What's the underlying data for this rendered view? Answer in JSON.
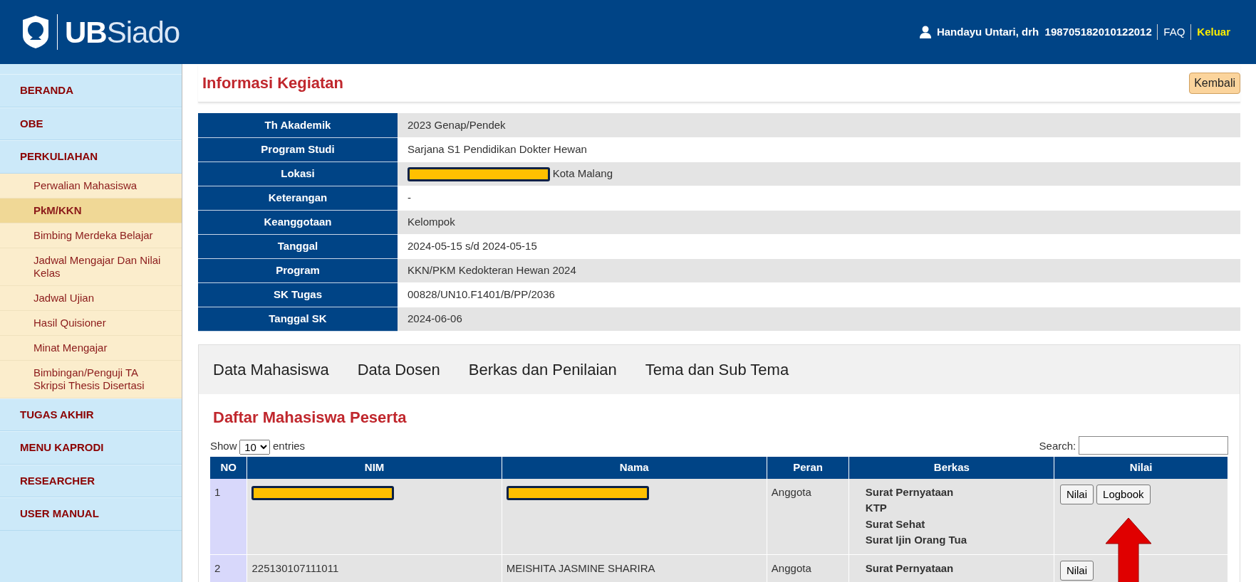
{
  "header": {
    "logo_bold": "UB",
    "logo_light": "Siado",
    "user": "Handayu Untari, drh  198705182010122012",
    "links": [
      {
        "label": "FAQ",
        "kind": "plain"
      },
      {
        "label": "Keluar",
        "kind": "highlight"
      }
    ]
  },
  "sidebar": {
    "items": [
      {
        "label": "BERANDA",
        "selected": false
      },
      {
        "label": "OBE",
        "selected": false
      },
      {
        "label": "PERKULIAHAN",
        "selected": false,
        "children": [
          {
            "label": "Perwalian Mahasiswa",
            "selected": false
          },
          {
            "label": "PkM/KKN",
            "selected": true
          },
          {
            "label": "Bimbing Merdeka Belajar",
            "selected": false
          },
          {
            "label": "Jadwal Mengajar Dan Nilai Kelas",
            "selected": false
          },
          {
            "label": "Jadwal Ujian",
            "selected": false
          },
          {
            "label": "Hasil Quisioner",
            "selected": false
          },
          {
            "label": "Minat Mengajar",
            "selected": false
          },
          {
            "label": "Bimbingan/Penguji TA Skripsi Thesis Disertasi",
            "selected": false
          }
        ]
      },
      {
        "label": "TUGAS AKHIR",
        "selected": false
      },
      {
        "label": "MENU KAPRODI",
        "selected": false
      },
      {
        "label": "RESEARCHER",
        "selected": false
      },
      {
        "label": "USER MANUAL",
        "selected": false
      }
    ]
  },
  "page": {
    "title": "Informasi Kegiatan",
    "back_button": "Kembali"
  },
  "info": [
    {
      "label": "Th Akademik",
      "value": "2023 Genap/Pendek",
      "redacted": false
    },
    {
      "label": "Program Studi",
      "value": "Sarjana S1 Pendidikan Dokter Hewan",
      "redacted": false
    },
    {
      "label": "Lokasi",
      "value": "Kota Malang",
      "redacted": true
    },
    {
      "label": "Keterangan",
      "value": "-",
      "redacted": false
    },
    {
      "label": "Keanggotaan",
      "value": "Kelompok",
      "redacted": false
    },
    {
      "label": "Tanggal",
      "value": "2024-05-15 s/d 2024-05-15",
      "redacted": false
    },
    {
      "label": "Program",
      "value": "KKN/PKM Kedokteran Hewan 2024",
      "redacted": false
    },
    {
      "label": "SK Tugas",
      "value": "00828/UN10.F1401/B/PP/2036",
      "redacted": false
    },
    {
      "label": "Tanggal SK",
      "value": "2024-06-06",
      "redacted": false
    }
  ],
  "tabs": [
    {
      "label": "Data Mahasiswa",
      "selected": false
    },
    {
      "label": "Data Dosen",
      "selected": false
    },
    {
      "label": "Berkas dan Penilaian",
      "selected": false
    },
    {
      "label": "Tema dan Sub Tema",
      "selected": false
    }
  ],
  "students": {
    "title": "Daftar Mahasiswa Peserta",
    "show_label": "Show",
    "page_size": "10",
    "entries_label": "entries",
    "search_label": "Search:",
    "columns": [
      "NO",
      "NIM",
      "Nama",
      "Peran",
      "Berkas",
      "Nilai"
    ],
    "rows": [
      {
        "no": "1",
        "redacted": true,
        "peran": "Anggota",
        "berkas": [
          "Surat Pernyataan",
          "KTP",
          "Surat Sehat",
          "Surat Ijin Orang Tua"
        ],
        "buttons": [
          "Nilai",
          "Logbook"
        ]
      },
      {
        "no": "2",
        "nim": "225130107111011",
        "nama": "MEISHITA JASMINE SHARIRA",
        "redacted": false,
        "peran": "Anggota",
        "berkas": [
          "Surat Pernyataan"
        ],
        "buttons": [
          "Nilai"
        ]
      }
    ]
  }
}
